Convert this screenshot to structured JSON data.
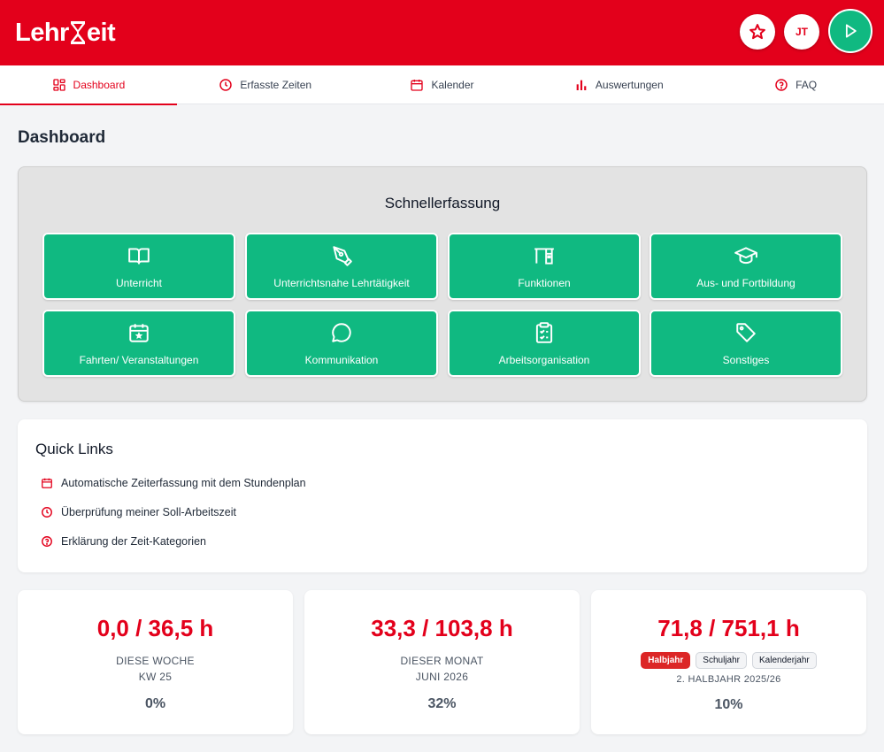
{
  "app": {
    "logo_left": "Lehr",
    "logo_right": "eit"
  },
  "header": {
    "avatar_initials": "JT"
  },
  "tabs": [
    {
      "label": "Dashboard",
      "icon": "grid-icon"
    },
    {
      "label": "Erfasste Zeiten",
      "icon": "clock-icon"
    },
    {
      "label": "Kalender",
      "icon": "calendar-icon"
    },
    {
      "label": "Auswertungen",
      "icon": "bar-chart-icon"
    },
    {
      "label": "FAQ",
      "icon": "help-circle-icon"
    }
  ],
  "page": {
    "title": "Dashboard"
  },
  "quick_entry": {
    "title": "Schnellerfassung",
    "buttons": [
      {
        "label": "Unterricht",
        "icon": "book-icon"
      },
      {
        "label": "Unterrichtsnahe Lehrtätigkeit",
        "icon": "pen-tool-icon"
      },
      {
        "label": "Funktionen",
        "icon": "desk-icon"
      },
      {
        "label": "Aus- und Fortbildung",
        "icon": "graduation-cap-icon"
      },
      {
        "label": "Fahrten/ Veranstaltungen",
        "icon": "calendar-star-icon"
      },
      {
        "label": "Kommunikation",
        "icon": "chat-bubble-icon"
      },
      {
        "label": "Arbeitsorganisation",
        "icon": "clipboard-check-icon"
      },
      {
        "label": "Sonstiges",
        "icon": "tag-icon"
      }
    ]
  },
  "quick_links": {
    "title": "Quick Links",
    "items": [
      {
        "label": "Automatische Zeiterfassung mit dem Stundenplan",
        "icon": "calendar-icon"
      },
      {
        "label": "Überprüfung meiner Soll-Arbeitszeit",
        "icon": "clock-icon"
      },
      {
        "label": "Erklärung der Zeit-Kategorien",
        "icon": "help-circle-icon"
      }
    ]
  },
  "stats": [
    {
      "value": "0,0 / 36,5 h",
      "label": "DIESE WOCHE",
      "sub": "KW 25",
      "percent": "0%"
    },
    {
      "value": "33,3 / 103,8 h",
      "label": "DIESER MONAT",
      "sub": "JUNI 2026",
      "percent": "32%"
    },
    {
      "value": "71,8 / 751,1 h",
      "period_options": [
        "Halbjahr",
        "Schuljahr",
        "Kalenderjahr"
      ],
      "selected_period": "Halbjahr",
      "sub": "2. HALBJAHR 2025/26",
      "percent": "10%"
    }
  ],
  "colors": {
    "brand_red": "#e3001b",
    "accent_green": "#10b981"
  }
}
